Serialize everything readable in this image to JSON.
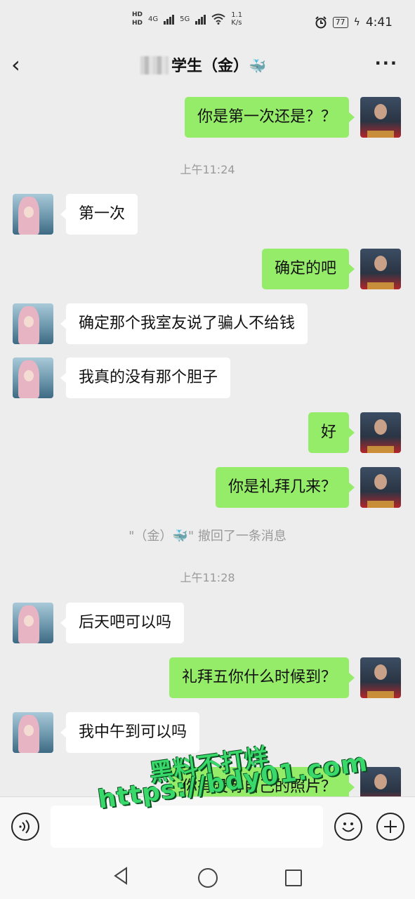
{
  "status_bar": {
    "hd_top": "HD",
    "hd_bottom": "HD",
    "net1": "4G",
    "net2": "5G",
    "speed_value": "1.1",
    "speed_unit": "K/s",
    "battery": "77",
    "time": "4:41",
    "icons": [
      "alarm-icon",
      "wifi-icon",
      "signal-icon",
      "battery-icon"
    ]
  },
  "header": {
    "title": "学生（金）",
    "title_emoji": "🐳",
    "back_icon": "‹",
    "more_icon": "···"
  },
  "messages": [
    {
      "from": "me",
      "text": "你是第一次还是？？"
    },
    {
      "type": "time",
      "text": "上午11:24"
    },
    {
      "from": "them",
      "text": "第一次"
    },
    {
      "from": "me",
      "text": "确定的吧"
    },
    {
      "from": "them",
      "text": "确定那个我室友说了骗人不给钱"
    },
    {
      "from": "them",
      "text": "我真的没有那个胆子"
    },
    {
      "from": "me",
      "text": "好"
    },
    {
      "from": "me",
      "text": "你是礼拜几来？"
    },
    {
      "type": "system",
      "text": "\"（金）🐳\" 撤回了一条消息"
    },
    {
      "type": "time",
      "text": "上午11:28"
    },
    {
      "from": "them",
      "text": "后天吧可以吗"
    },
    {
      "from": "me",
      "text": "礼拜五你什么时候到？"
    },
    {
      "from": "them",
      "text": "我中午到可以吗"
    },
    {
      "from": "me",
      "text": "你有没有自己的照片？"
    }
  ],
  "input_bar": {
    "voice_icon": "voice-icon",
    "emoji_icon": "emoji-icon",
    "plus_icon": "plus-icon",
    "text_value": ""
  },
  "watermark": {
    "line1": "黑料不打烊",
    "line2": "https://bdy01.com"
  },
  "colors": {
    "background": "#ededed",
    "bubble_me": "#95ec69",
    "bubble_them": "#ffffff"
  }
}
